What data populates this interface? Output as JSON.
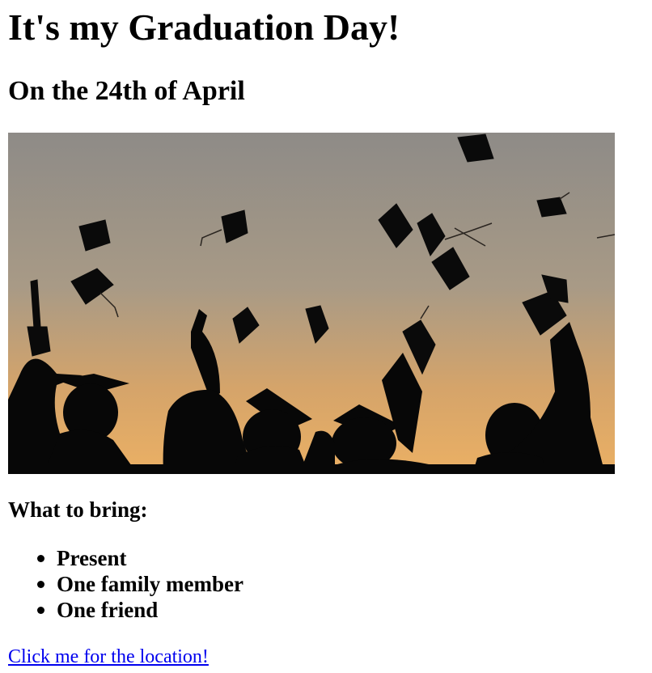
{
  "page": {
    "title": "It's my Graduation Day!",
    "subtitle": "On the 24th of April"
  },
  "hero_image": {
    "alt": "Graduates silhouetted against a sunset sky throwing caps in the air"
  },
  "bring": {
    "heading": "What to bring:",
    "items": [
      {
        "label": "Present"
      },
      {
        "label": "One family member"
      },
      {
        "label": "One friend"
      }
    ]
  },
  "location_link": {
    "label": "Click me for the location!"
  },
  "colors": {
    "link": "#0000ee",
    "text": "#000000",
    "sky_top": "#8f8c86",
    "sky_bottom": "#e7a65a"
  }
}
